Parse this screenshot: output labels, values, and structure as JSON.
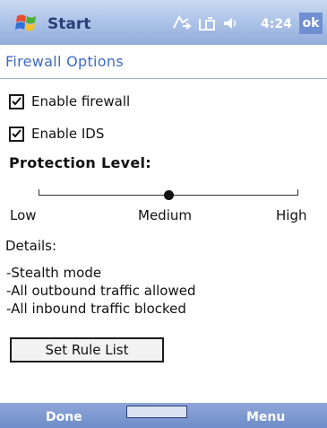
{
  "titlebar": {
    "app_name": "Start",
    "time": "4:24",
    "ok_label": "ok",
    "icons": [
      "windows-flag-icon",
      "connectivity-icon",
      "phone-signal-icon",
      "volume-icon"
    ]
  },
  "page": {
    "title": "Firewall Options"
  },
  "options": {
    "enable_firewall": {
      "label": "Enable firewall",
      "checked": true
    },
    "enable_ids": {
      "label": "Enable IDS",
      "checked": true
    }
  },
  "protection": {
    "heading": "Protection Level:",
    "levels": [
      "Low",
      "Medium",
      "High"
    ],
    "selected": "Medium"
  },
  "details": {
    "heading": "Details:",
    "items": [
      "-Stealth mode",
      "-All outbound traffic allowed",
      "-All inbound traffic blocked"
    ]
  },
  "buttons": {
    "set_rule_list": "Set Rule List"
  },
  "softkeys": {
    "left": "Done",
    "right": "Menu"
  },
  "colors": {
    "accent": "#3f6ac4",
    "titlebar": "#a9c0e6",
    "softkey_bar": "#7d98cf"
  }
}
